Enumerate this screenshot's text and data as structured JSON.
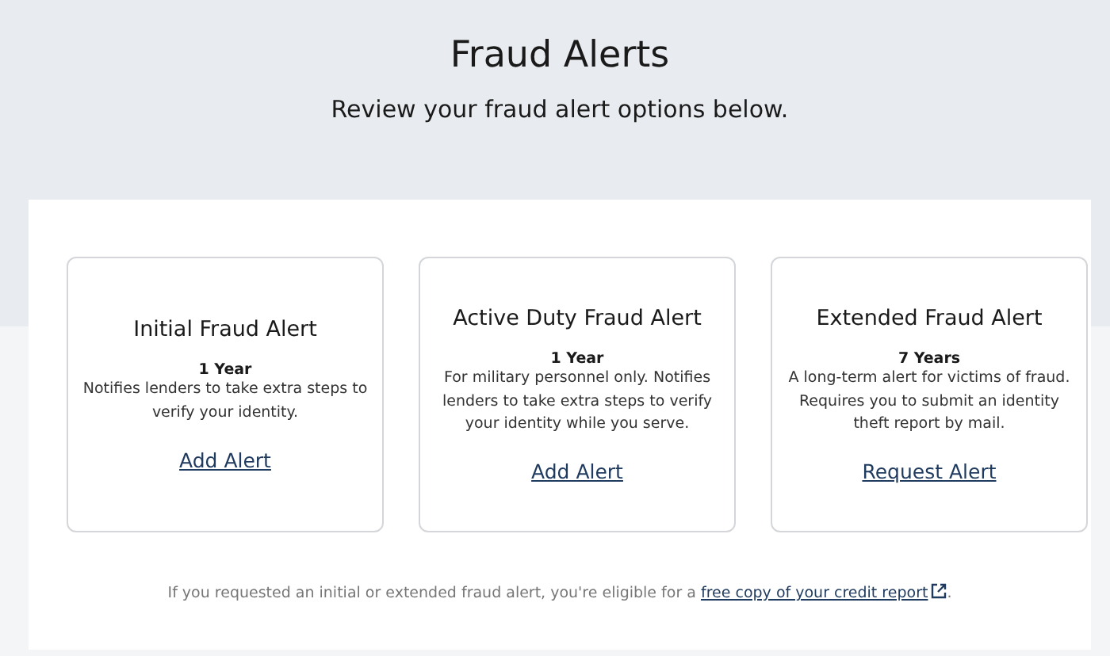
{
  "header": {
    "title": "Fraud Alerts",
    "subtitle": "Review your fraud alert options below."
  },
  "cards": [
    {
      "title": "Initial Fraud Alert",
      "duration": "1 Year",
      "description": "Notifies lenders to take extra steps to verify your identity.",
      "action": "Add Alert"
    },
    {
      "title": "Active Duty Fraud Alert",
      "duration": "1 Year",
      "description": "For military personnel only. Notifies lenders to take extra steps to verify your identity while you serve.",
      "action": "Add Alert"
    },
    {
      "title": "Extended Fraud Alert",
      "duration": "7 Years",
      "description": "A long-term alert for victims of fraud. Requires you to submit an identity theft report by mail.",
      "action": "Request Alert"
    }
  ],
  "footnote": {
    "text": "If you requested an initial or extended fraud alert, you're eligible for a",
    "link": "free copy of your credit report",
    "end": "."
  }
}
